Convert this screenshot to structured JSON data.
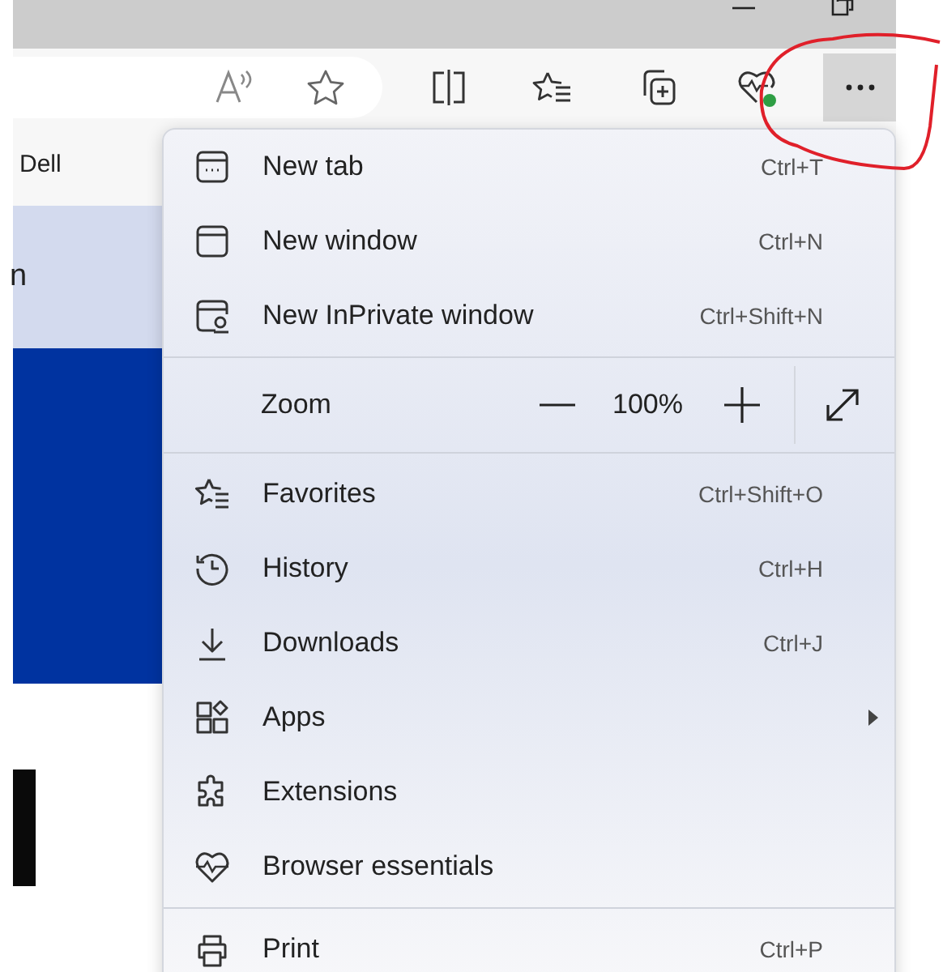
{
  "toolbar": {
    "more_button": {
      "selected": true
    }
  },
  "bookmarks_bar": {
    "items": [
      "Dell"
    ]
  },
  "page": {
    "heading_fragment": "n"
  },
  "menu": {
    "items": [
      {
        "kind": "item",
        "label": "New tab",
        "shortcut": "Ctrl+T"
      },
      {
        "kind": "item",
        "label": "New window",
        "shortcut": "Ctrl+N"
      },
      {
        "kind": "item",
        "label": "New InPrivate window",
        "shortcut": "Ctrl+Shift+N"
      },
      {
        "kind": "divider"
      },
      {
        "kind": "zoom",
        "label": "Zoom",
        "value": "100%"
      },
      {
        "kind": "divider"
      },
      {
        "kind": "item",
        "label": "Favorites",
        "shortcut": "Ctrl+Shift+O"
      },
      {
        "kind": "item",
        "label": "History",
        "shortcut": "Ctrl+H"
      },
      {
        "kind": "item",
        "label": "Downloads",
        "shortcut": "Ctrl+J"
      },
      {
        "kind": "item",
        "label": "Apps",
        "submenu": true
      },
      {
        "kind": "item",
        "label": "Extensions"
      },
      {
        "kind": "item",
        "label": "Browser essentials"
      },
      {
        "kind": "divider"
      },
      {
        "kind": "item",
        "label": "Print",
        "shortcut": "Ctrl+P"
      }
    ]
  }
}
